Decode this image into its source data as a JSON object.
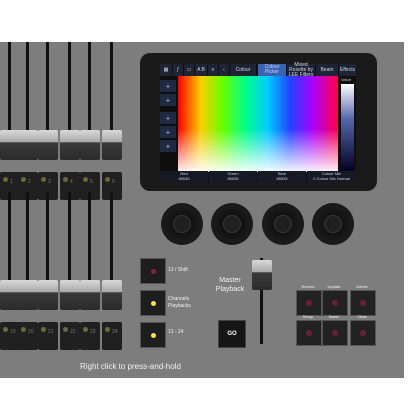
{
  "colors": {
    "desk": "#7d7d7d",
    "screen_bg": "#0f0f0f",
    "tab_selected": "#3a63b6",
    "led_on": "#ffe24a",
    "led_dim": "#6b6a3a",
    "led_red": "#6a2130"
  },
  "screen": {
    "tabs": [
      {
        "label": "Colour",
        "selected": false
      },
      {
        "label": "Colour Picker",
        "selected": true
      },
      {
        "label": "Mixed Rosette by LEE Filters",
        "selected": false
      },
      {
        "label": "Beam",
        "selected": false
      },
      {
        "label": "Effects",
        "selected": false
      }
    ],
    "toolbar_icons": [
      "grid-icon",
      "fader-icon",
      "select-icon",
      "ab-icon",
      "back-icon",
      "forward-icon"
    ],
    "toolbar_text": [
      "A B",
      "≡"
    ],
    "side_buttons": [
      "+",
      "+",
      "+",
      "+",
      "+"
    ],
    "value_label": "Value",
    "readouts": [
      {
        "label": "Red",
        "value": "65535"
      },
      {
        "label": "Green",
        "value": "65535"
      },
      {
        "label": "Blue",
        "value": "65535"
      },
      {
        "label": "Colour Mix",
        "value": "0 Colour Mix Normal"
      }
    ]
  },
  "upper_faders": [
    {
      "number": "1"
    },
    {
      "number": "2"
    },
    {
      "number": "3"
    },
    {
      "number": "4"
    },
    {
      "number": "5"
    },
    {
      "number": "6"
    }
  ],
  "lower_faders": [
    {
      "number": "19"
    },
    {
      "number": "20"
    },
    {
      "number": "21"
    },
    {
      "number": "22"
    },
    {
      "number": "23"
    },
    {
      "number": "24"
    }
  ],
  "playback_pages": [
    {
      "label": "13 / Shift",
      "led": "red"
    },
    {
      "label": "Channels Playbacks",
      "led": "yellow"
    },
    {
      "label": "13 - 24",
      "led": "yellow"
    }
  ],
  "master": {
    "label": "Master Playback",
    "go_label": "GO"
  },
  "keys": [
    {
      "label": "Record"
    },
    {
      "label": "Update"
    },
    {
      "label": "Delete"
    },
    {
      "label": "Setup"
    },
    {
      "label": "Name"
    },
    {
      "label": "Clear"
    }
  ],
  "hint": "Right click to press-and-hold"
}
